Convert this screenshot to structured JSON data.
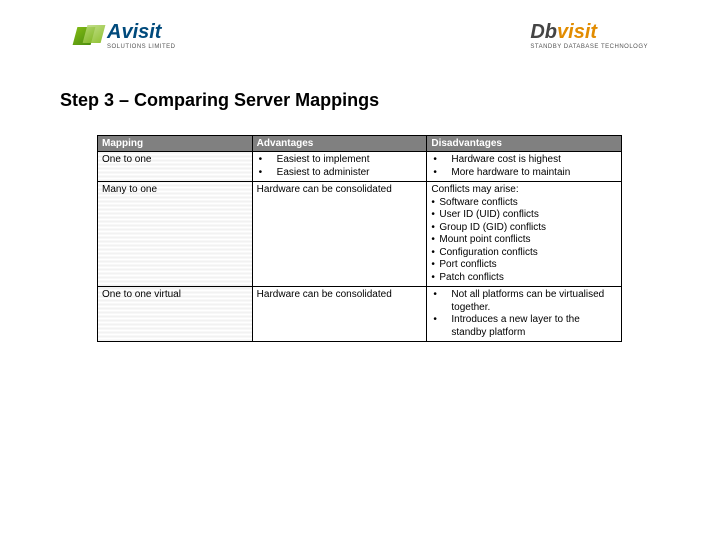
{
  "header": {
    "logo_left_text": "Avisit",
    "logo_left_sub": "SOLUTIONS LIMITED",
    "logo_right_db": "Db",
    "logo_right_visit": "visit",
    "logo_right_sub": "STANDBY DATABASE TECHNOLOGY"
  },
  "title": "Step 3 – Comparing Server Mappings",
  "table": {
    "headers": {
      "c1": "Mapping",
      "c2": "Advantages",
      "c3": "Disadvantages"
    },
    "rows": [
      {
        "mapping": "One to one",
        "adv": [
          "Easiest to implement",
          "Easiest to administer"
        ],
        "dis": [
          "Hardware cost is highest",
          "More hardware to maintain"
        ]
      },
      {
        "mapping": "Many to one",
        "adv_text": "Hardware can be consolidated",
        "dis_lead": "Conflicts may arise:",
        "dis": [
          "Software conflicts",
          "User ID (UID) conflicts",
          "Group ID (GID) conflicts",
          "Mount point conflicts",
          "Configuration conflicts",
          "Port conflicts",
          "Patch conflicts"
        ]
      },
      {
        "mapping": "One to one virtual",
        "adv_text": "Hardware can be consolidated",
        "dis": [
          "Not all platforms can be virtualised together.",
          "Introduces a new layer to the standby platform"
        ]
      }
    ]
  }
}
